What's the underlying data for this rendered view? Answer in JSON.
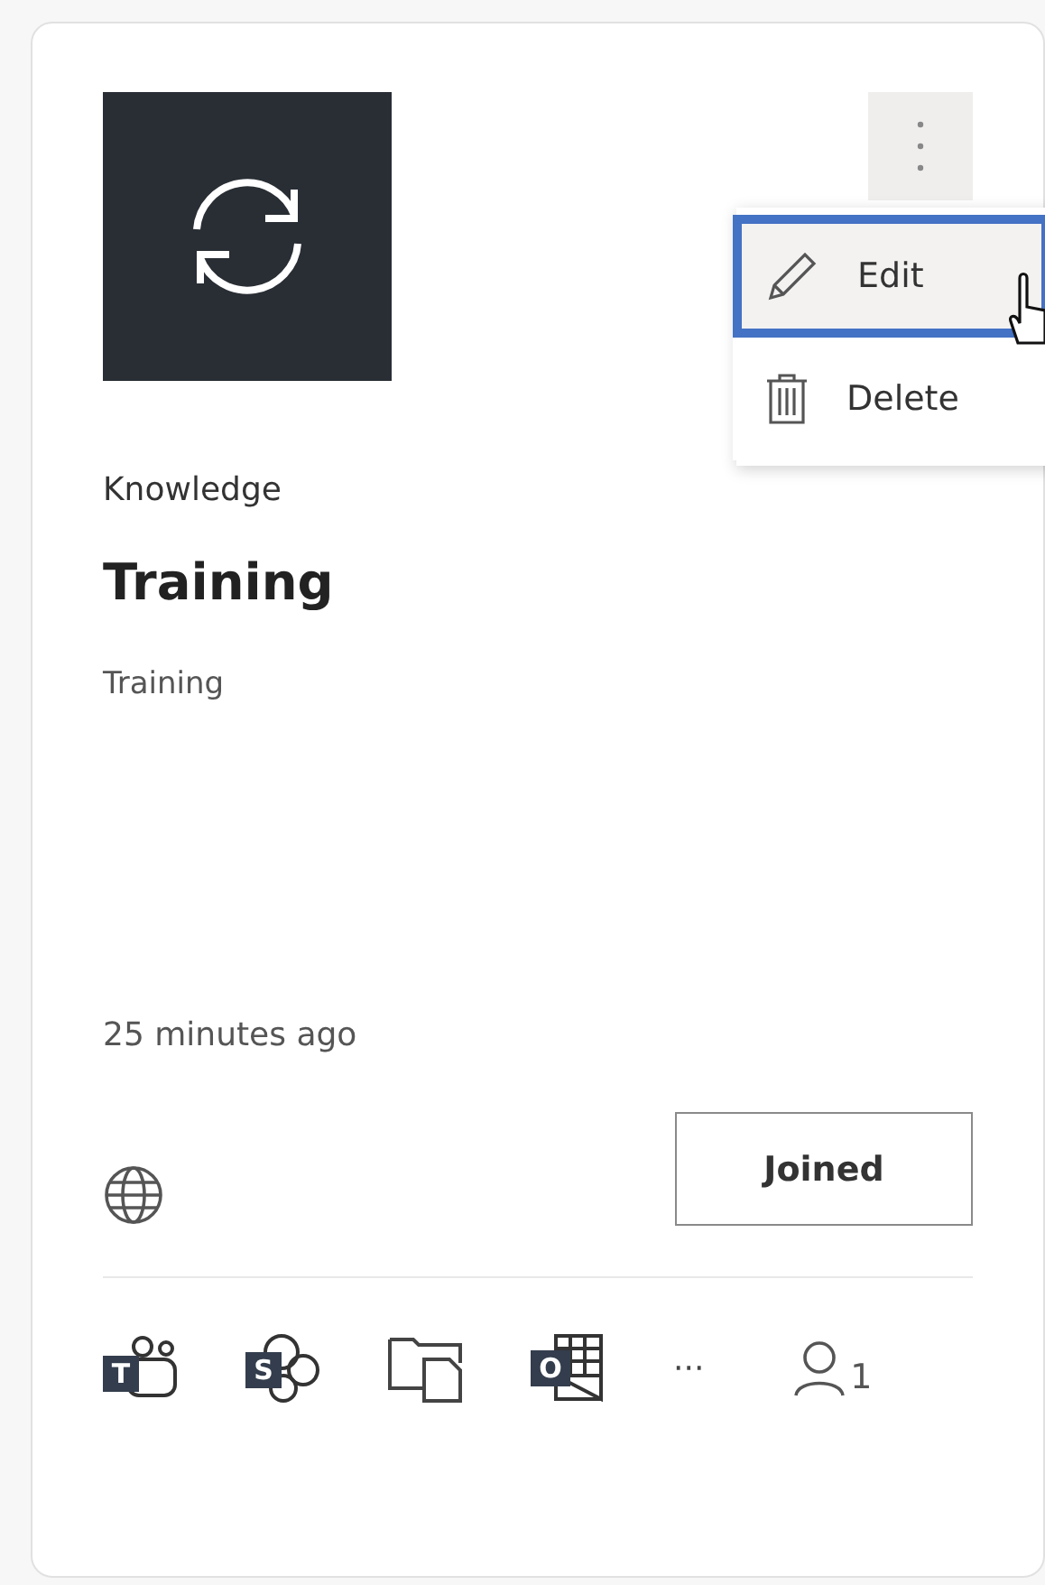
{
  "card": {
    "category": "Knowledge",
    "title": "Training",
    "description": "Training",
    "updated": "25 minutes ago",
    "join_button": "Joined",
    "member_count": "1"
  },
  "apps": [
    {
      "kind": "teams",
      "letter": "T"
    },
    {
      "kind": "sharepoint",
      "letter": "S"
    },
    {
      "kind": "files"
    },
    {
      "kind": "outlook",
      "letter": "O"
    },
    {
      "kind": "more",
      "label": "···"
    }
  ],
  "menu": {
    "items": [
      {
        "kind": "edit",
        "label": "Edit",
        "selected": true
      },
      {
        "kind": "delete",
        "label": "Delete",
        "selected": false
      }
    ]
  }
}
